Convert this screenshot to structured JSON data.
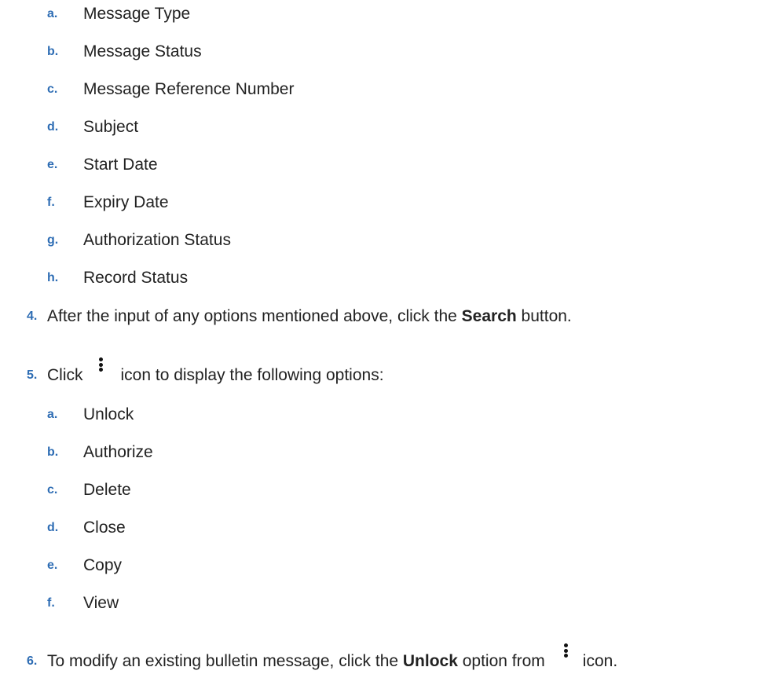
{
  "colors": {
    "marker": "#2e6db4",
    "text": "#222222",
    "icon": "#111111"
  },
  "search_fields": [
    {
      "marker": "a.",
      "label": "Message Type"
    },
    {
      "marker": "b.",
      "label": "Message Status"
    },
    {
      "marker": "c.",
      "label": "Message Reference Number"
    },
    {
      "marker": "d.",
      "label": "Subject"
    },
    {
      "marker": "e.",
      "label": "Start Date"
    },
    {
      "marker": "f.",
      "label": "Expiry Date"
    },
    {
      "marker": "g.",
      "label": "Authorization Status"
    },
    {
      "marker": "h.",
      "label": "Record Status"
    }
  ],
  "step4": {
    "marker": "4.",
    "text_before": "After the input of any options mentioned above, click the ",
    "bold": "Search",
    "text_after": " button."
  },
  "step5": {
    "marker": "5.",
    "text_before": "Click",
    "icon": "kebab-menu-icon",
    "text_after": "icon to display the following options:"
  },
  "action_options": [
    {
      "marker": "a.",
      "label": "Unlock"
    },
    {
      "marker": "b.",
      "label": "Authorize"
    },
    {
      "marker": "c.",
      "label": "Delete"
    },
    {
      "marker": "d.",
      "label": "Close"
    },
    {
      "marker": "e.",
      "label": "Copy"
    },
    {
      "marker": "f.",
      "label": "View"
    }
  ],
  "step6": {
    "marker": "6.",
    "text_before": "To modify an existing bulletin message, click the ",
    "bold": "Unlock",
    "text_middle": " option from",
    "icon": "kebab-menu-icon",
    "text_after": "icon."
  }
}
